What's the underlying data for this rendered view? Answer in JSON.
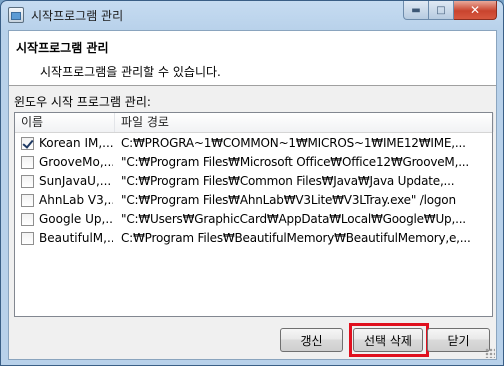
{
  "window": {
    "title": "시작프로그램 관리",
    "icon": "window-app-icon",
    "controls": {
      "minimize": "minimize-icon",
      "maximize": "maximize-icon",
      "close": "close-icon"
    }
  },
  "header": {
    "title": "시작프로그램 관리",
    "description": "시작프로그램을 관리할 수 있습니다."
  },
  "list": {
    "group_label": "윈도우 시작 프로그램 관리:",
    "columns": [
      "이름",
      "파일 경로"
    ],
    "rows": [
      {
        "checked": true,
        "name": "Korean IM,...",
        "path": "C:₩PROGRA~1₩COMMON~1₩MICROS~1₩IME12₩IME,..."
      },
      {
        "checked": false,
        "name": "GrooveMo,...",
        "path": "\"C:₩Program Files₩Microsoft Office₩Office12₩GrooveM,..."
      },
      {
        "checked": false,
        "name": "SunJavaU,...",
        "path": "\"C:₩Program Files₩Common Files₩Java₩Java Update,..."
      },
      {
        "checked": false,
        "name": "AhnLab V3,...",
        "path": "\"C:₩Program Files₩AhnLab₩V3Lite₩V3LTray.exe\" /logon"
      },
      {
        "checked": false,
        "name": "Google Up,...",
        "path": "\"C:₩Users₩GraphicCard₩AppData₩Local₩Google₩Up,..."
      },
      {
        "checked": false,
        "name": "BeautifulM,...",
        "path": "C:₩Program Files₩BeautifulMemory₩BeautifulMemory,e,..."
      }
    ]
  },
  "buttons": {
    "refresh": "갱신",
    "delete_selected": "선택 삭제",
    "close": "닫기"
  },
  "colors": {
    "highlight": "#e0101e"
  }
}
